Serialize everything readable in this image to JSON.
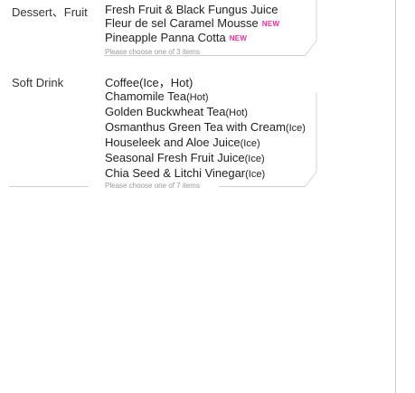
{
  "sections": [
    {
      "category": "Dessert、Fruit",
      "items": [
        {
          "name": "Fresh Fruit & Black Fungus Juice",
          "note": "",
          "badge": ""
        },
        {
          "name": "Fleur de sel Caramel Mousse",
          "note": "",
          "badge": "NEW"
        },
        {
          "name": "Pineapple Panna Cotta",
          "note": "",
          "badge": "NEW"
        }
      ],
      "hint": "Please choose one of 3 items"
    },
    {
      "category": "Soft Drink",
      "items": [
        {
          "name": "Coffee(Ice，Hot)",
          "note": "",
          "badge": ""
        },
        {
          "name": "Chamomile Tea",
          "note": "(Hot)",
          "badge": ""
        },
        {
          "name": "Golden Buckwheat Tea",
          "note": "(Hot)",
          "badge": ""
        },
        {
          "name": "Osmanthus Green Tea with Cream",
          "note": "(Ice)",
          "badge": ""
        },
        {
          "name": "Houseleek and Aloe Juice",
          "note": "(Ice)",
          "badge": ""
        },
        {
          "name": "Seasonal Fresh Fruit Juice",
          "note": "(Ice)",
          "badge": ""
        },
        {
          "name": "Chia Seed & Litchi Vinegar",
          "note": "(Ice)",
          "badge": ""
        }
      ],
      "hint": "Please choose one of 7 items"
    }
  ]
}
